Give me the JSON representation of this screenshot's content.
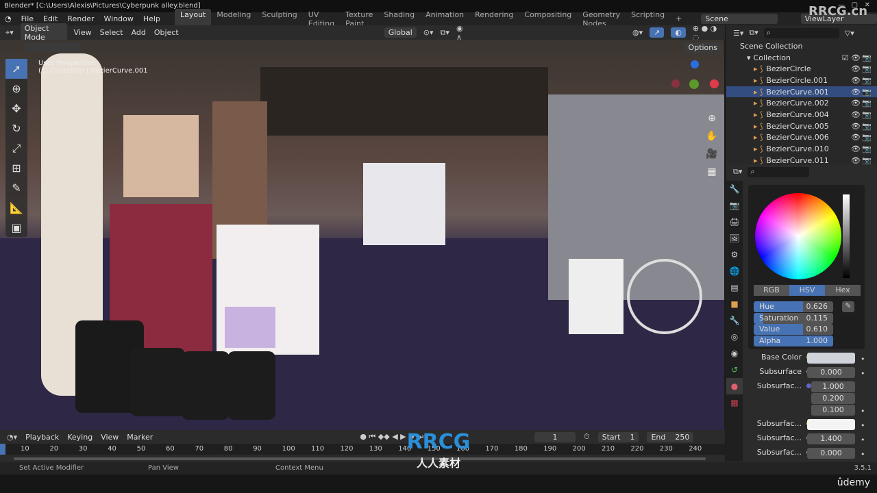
{
  "title": "Blender* [C:\\Users\\Alexis\\Pictures\\Cyberpunk alley.blend]",
  "menu": [
    "File",
    "Edit",
    "Render",
    "Window",
    "Help"
  ],
  "workspaces": [
    "Layout",
    "Modeling",
    "Sculpting",
    "UV Editing",
    "Texture Paint",
    "Shading",
    "Animation",
    "Rendering",
    "Compositing",
    "Geometry Nodes",
    "Scripting"
  ],
  "scene": "Scene",
  "view_layer": "ViewLayer",
  "header": {
    "mode": "Object Mode",
    "menus": [
      "View",
      "Select",
      "Add",
      "Object"
    ],
    "orientation": "Global",
    "options": "Options"
  },
  "viewport": {
    "perspective": "User Perspective",
    "collection_info": "(1) Collection | BezierCurve.001"
  },
  "outliner": {
    "root": "Scene Collection",
    "collection": "Collection",
    "items": [
      {
        "name": "BezierCircle",
        "selected": false
      },
      {
        "name": "BezierCircle.001",
        "selected": false
      },
      {
        "name": "BezierCurve.001",
        "selected": true
      },
      {
        "name": "BezierCurve.002",
        "selected": false
      },
      {
        "name": "BezierCurve.004",
        "selected": false
      },
      {
        "name": "BezierCurve.005",
        "selected": false
      },
      {
        "name": "BezierCurve.006",
        "selected": false
      },
      {
        "name": "BezierCurve.010",
        "selected": false
      },
      {
        "name": "BezierCurve.011",
        "selected": false
      }
    ]
  },
  "picker": {
    "modes": [
      "RGB",
      "HSV",
      "Hex"
    ],
    "active_mode": "HSV",
    "fields": [
      {
        "label": "Hue",
        "value": "0.626"
      },
      {
        "label": "Saturation",
        "value": "0.115"
      },
      {
        "label": "Value",
        "value": "0.610"
      },
      {
        "label": "Alpha",
        "value": "1.000"
      }
    ]
  },
  "material": [
    {
      "label": "Base Color",
      "type": "color",
      "color": "#cfd3da"
    },
    {
      "label": "Subsurface",
      "value": "0.000"
    },
    {
      "label": "Subsurfac...",
      "values": [
        "1.000",
        "0.200",
        "0.100"
      ]
    },
    {
      "label": "Subsurfac...",
      "type": "color",
      "color": "#f4f4f4"
    },
    {
      "label": "Subsurfac...",
      "value": "1.400"
    },
    {
      "label": "Subsurfac...",
      "value": "0.000"
    }
  ],
  "timeline": {
    "menus": [
      "Playback",
      "Keying",
      "View",
      "Marker"
    ],
    "current_frame": "1",
    "start_label": "Start",
    "start": "1",
    "end_label": "End",
    "end": "250",
    "ticks": [
      "10",
      "20",
      "30",
      "40",
      "50",
      "60",
      "70",
      "80",
      "90",
      "100",
      "110",
      "120",
      "130",
      "140",
      "150",
      "160",
      "170",
      "180",
      "190",
      "200",
      "210",
      "220",
      "230",
      "240"
    ]
  },
  "status": {
    "items": [
      "Set Active Modifier",
      "Pan View",
      "Context Menu"
    ],
    "version": "3.5.1"
  },
  "watermarks": {
    "site": "RRCG.cn",
    "logo": "RRCG",
    "logo_cn": "人人素材",
    "udemy": "ûdemy"
  }
}
